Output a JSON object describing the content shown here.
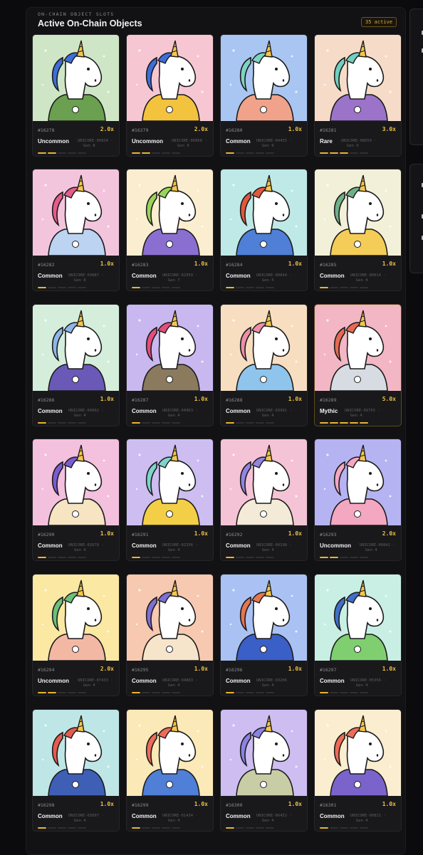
{
  "section": {
    "eyebrow": "ON-CHAIN OBJECT SLOTS",
    "title": "Active On-Chain Objects",
    "badge": "35 active"
  },
  "colors": {
    "accent": "#e8b531",
    "multiplier": "#f0c040"
  },
  "cards": [
    {
      "token": "#16278",
      "mult": "2.0x",
      "rarity": "Uncommon",
      "unicore": "UNICORE-06834 ·",
      "gen": "Gen 8",
      "level": 2,
      "bg": "#cfe6c6",
      "mane": "#3d6fd8",
      "outfit": "#6aa04f",
      "icon": "camera-icon"
    },
    {
      "token": "#16279",
      "mult": "2.0x",
      "rarity": "Uncommon",
      "unicore": "UNICORE-06868 ·",
      "gen": "Gen 9",
      "level": 2,
      "bg": "#f6c7d3",
      "mane": "#3d6fd8",
      "outfit": "#f3c33e",
      "icon": "bee-hood-icon"
    },
    {
      "token": "#16280",
      "mult": "1.0x",
      "rarity": "Common",
      "unicore": "UNICORE-04455 ·",
      "gen": "Gen 9",
      "level": 1,
      "bg": "#a9c6f2",
      "mane": "#7ed3c2",
      "outfit": "#f0a38a",
      "icon": "mushroom-icon"
    },
    {
      "token": "#16281",
      "mult": "3.0x",
      "rarity": "Rare",
      "unicore": "UNICORE-08659 ·",
      "gen": "Gen 9",
      "level": 3,
      "bg": "#f6dcc8",
      "mane": "#6fd0c0",
      "outfit": "#9b73c9",
      "icon": "visor-icon"
    },
    {
      "token": "#16282",
      "mult": "1.0x",
      "rarity": "Common",
      "unicore": "UNICORE-03887 ·",
      "gen": "Gen 8",
      "level": 1,
      "bg": "#f3c5dd",
      "mane": "#e55c8a",
      "outfit": "#bcd3f2",
      "icon": "leaf-icon"
    },
    {
      "token": "#16283",
      "mult": "1.0x",
      "rarity": "Common",
      "unicore": "UNICORE-02950 ·",
      "gen": "Gen 7",
      "level": 1,
      "bg": "#fbeed0",
      "mane": "#9ad35a",
      "outfit": "#8a6fd1",
      "icon": "flower-icon"
    },
    {
      "token": "#16284",
      "mult": "1.0x",
      "rarity": "Common",
      "unicore": "UNICORE-00844 ·",
      "gen": "Gen 5",
      "level": 1,
      "bg": "#bfe9e6",
      "mane": "#e0583e",
      "outfit": "#4f7fd6",
      "icon": "heart-icon"
    },
    {
      "token": "#16285",
      "mult": "1.0x",
      "rarity": "Common",
      "unicore": "UNICORE-00014 ·",
      "gen": "Gen 4",
      "level": 1,
      "bg": "#f3f0da",
      "mane": "#6fb088",
      "outfit": "#f3cd57",
      "icon": "diamond-icon"
    },
    {
      "token": "#16286",
      "mult": "1.0x",
      "rarity": "Common",
      "unicore": "UNICORE-04902 ·",
      "gen": "Gen 4",
      "level": 1,
      "bg": "#d5eedc",
      "mane": "#8fb6e8",
      "outfit": "#6b59b8",
      "icon": "star-icon"
    },
    {
      "token": "#16287",
      "mult": "1.0x",
      "rarity": "Common",
      "unicore": "UNICORE-04963 ·",
      "gen": "Gen 4",
      "level": 1,
      "bg": "#c9b8f0",
      "mane": "#e34e7c",
      "outfit": "#8b7a5d",
      "icon": "vest-icon"
    },
    {
      "token": "#16288",
      "mult": "1.0x",
      "rarity": "Common",
      "unicore": "UNICORE-03991 ·",
      "gen": "Gen 4",
      "level": 1,
      "bg": "#f7dec0",
      "mane": "#ee8fa8",
      "outfit": "#8fc4ec",
      "icon": "heart-icon"
    },
    {
      "token": "#16289",
      "mult": "5.0x",
      "rarity": "Mythic",
      "unicore": "UNICORE-09765 ·",
      "gen": "Gen 4",
      "level": 5,
      "bg": "#f2b6c4",
      "mane": "#e56a52",
      "outfit": "#d7dbe2",
      "icon": "robot-icon"
    },
    {
      "token": "#16290",
      "mult": "1.0x",
      "rarity": "Common",
      "unicore": "UNICORE-02678 ·",
      "gen": "Gen 4",
      "level": 1,
      "bg": "#f3c0dd",
      "mane": "#7a5cd0",
      "outfit": "#f6e4c2",
      "icon": "flower-icon"
    },
    {
      "token": "#16291",
      "mult": "1.0x",
      "rarity": "Common",
      "unicore": "UNICORE-02336 ·",
      "gen": "Gen 4",
      "level": 1,
      "bg": "#cdbdf1",
      "mane": "#7fd3cd",
      "outfit": "#f3cf47",
      "icon": "flower-icon"
    },
    {
      "token": "#16292",
      "mult": "1.0x",
      "rarity": "Common",
      "unicore": "UNICORE-00198 ·",
      "gen": "Gen 4",
      "level": 1,
      "bg": "#f5c3d6",
      "mane": "#9284e0",
      "outfit": "#f3ebd8",
      "icon": "apron-icon"
    },
    {
      "token": "#16293",
      "mult": "2.0x",
      "rarity": "Uncommon",
      "unicore": "UNICORE-00842 ·",
      "gen": "Gen 4",
      "level": 2,
      "bg": "#b6b3f2",
      "mane": "#f4a7c1",
      "outfit": "#f4a7c1",
      "icon": "axolotl-hood-icon"
    },
    {
      "token": "#16294",
      "mult": "2.0x",
      "rarity": "Uncommon",
      "unicore": "UNICORE-07433 ·",
      "gen": "Gen 4",
      "level": 2,
      "bg": "#fae8a3",
      "mane": "#6cc07a",
      "outfit": "#f3b8a4",
      "icon": "goggles-icon"
    },
    {
      "token": "#16295",
      "mult": "1.0x",
      "rarity": "Common",
      "unicore": "UNICORE-04883 ·",
      "gen": "Gen 4",
      "level": 1,
      "bg": "#f7c9b0",
      "mane": "#7e6fd6",
      "outfit": "#f6e4cb",
      "icon": "planet-icon"
    },
    {
      "token": "#16296",
      "mult": "1.0x",
      "rarity": "Common",
      "unicore": "UNICORE-03206 ·",
      "gen": "Gen 4",
      "level": 1,
      "bg": "#a9c2f3",
      "mane": "#e77550",
      "outfit": "#3a5fc6",
      "icon": "apple-icon"
    },
    {
      "token": "#16297",
      "mult": "1.0x",
      "rarity": "Common",
      "unicore": "UNICORE-05356 ·",
      "gen": "Gen 4",
      "level": 1,
      "bg": "#c9efe4",
      "mane": "#3f6fc9",
      "outfit": "#7fcf70",
      "icon": "star-icon"
    },
    {
      "token": "#16298",
      "mult": "1.0x",
      "rarity": "Common",
      "unicore": "UNICORE-03097 ·",
      "gen": "Gen 4",
      "level": 1,
      "bg": "#bfe6e6",
      "mane": "#e65b4d",
      "outfit": "#3f5fb7",
      "icon": "vest-icon"
    },
    {
      "token": "#16299",
      "mult": "1.0x",
      "rarity": "Common",
      "unicore": "UNICORE-01434 ·",
      "gen": "Gen 4",
      "level": 1,
      "bg": "#fbe9b8",
      "mane": "#ee6b58",
      "outfit": "#4f7fd6",
      "icon": "star-icon"
    },
    {
      "token": "#16300",
      "mult": "1.0x",
      "rarity": "Common",
      "unicore": "UNICORE-06452 ·",
      "gen": "Gen 4",
      "level": 1,
      "bg": "#cdbdf1",
      "mane": "#8b82e3",
      "outfit": "#c9cda6",
      "icon": "apple-icon"
    },
    {
      "token": "#16301",
      "mult": "1.0x",
      "rarity": "Common",
      "unicore": "UNICORE-00811 ·",
      "gen": "Gen 4",
      "level": 1,
      "bg": "#fbeed0",
      "mane": "#ee6b58",
      "outfit": "#7b63cc",
      "icon": "planet-icon"
    }
  ]
}
